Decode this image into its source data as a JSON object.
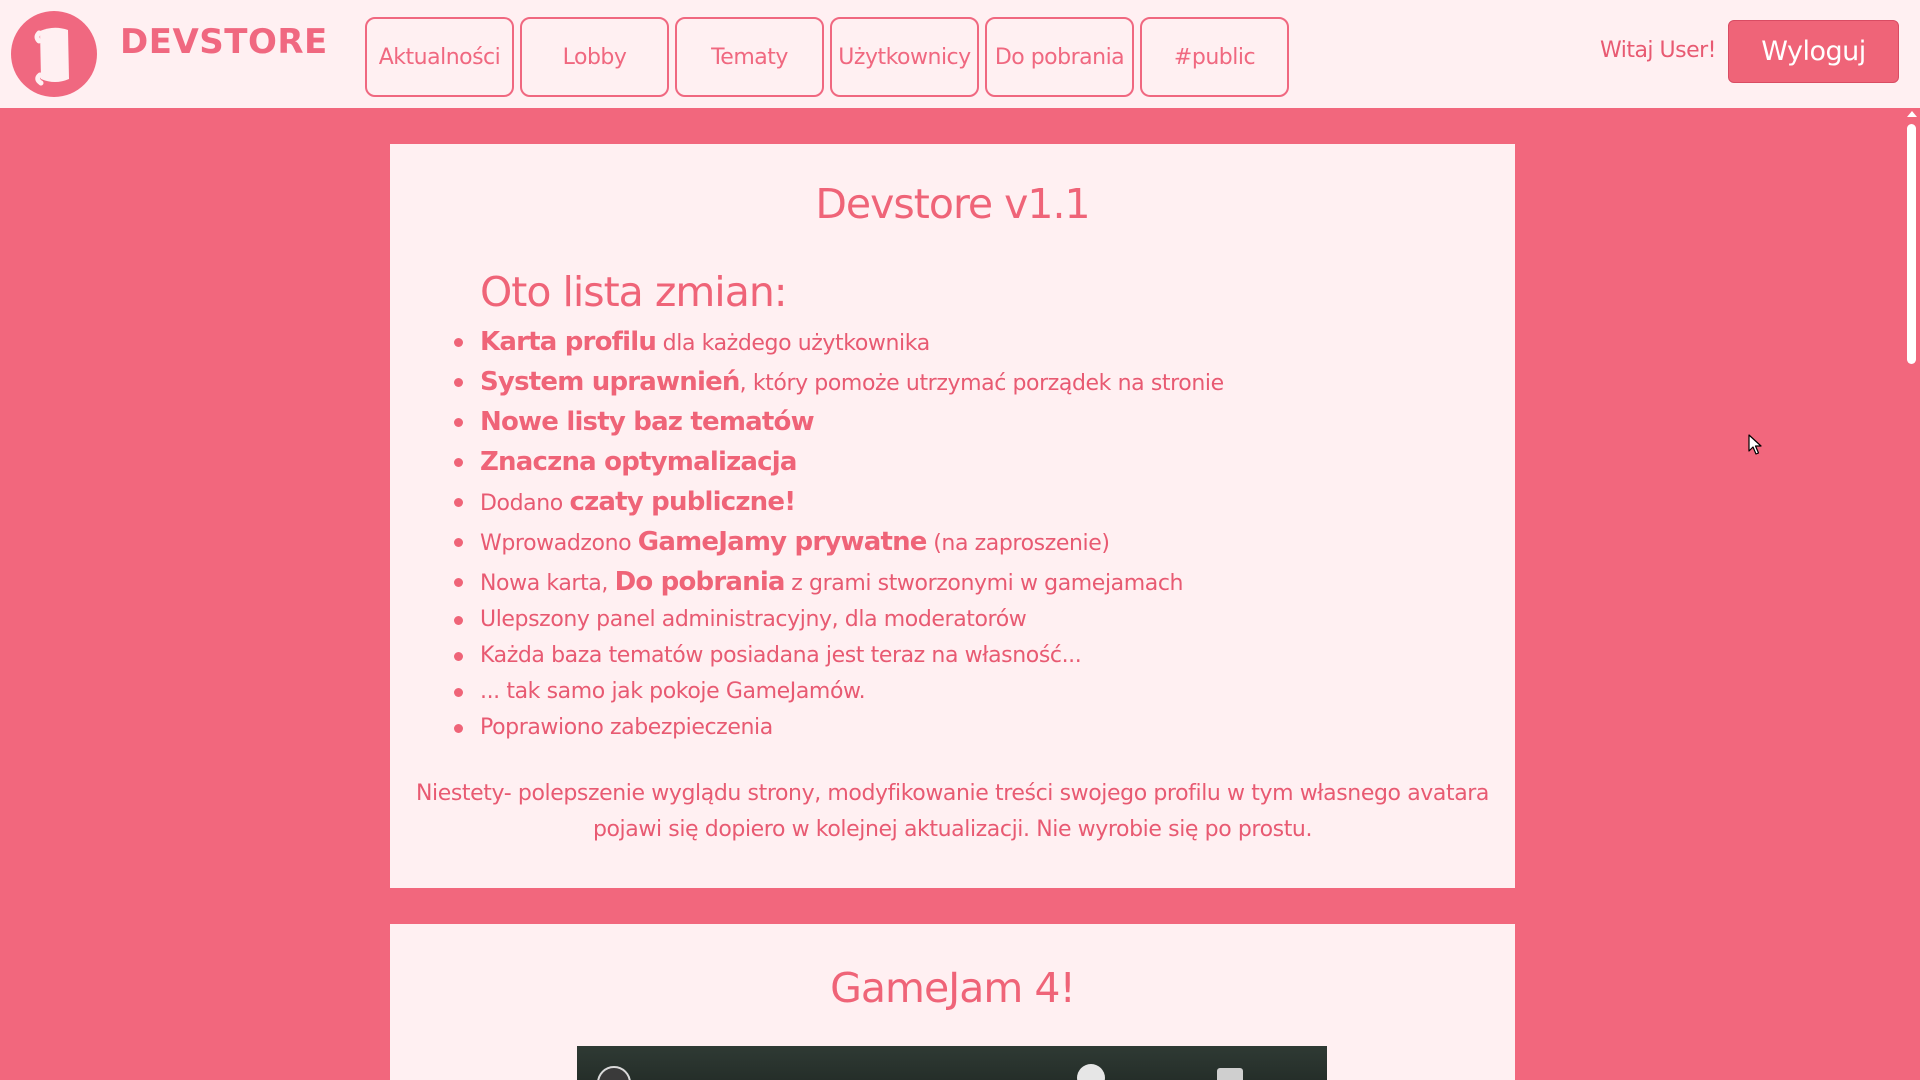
{
  "header": {
    "brand": "DEVSTORE",
    "nav": [
      "Aktualności",
      "Lobby",
      "Tematy",
      "Użytkownicy",
      "Do pobrania",
      "#public"
    ],
    "welcome": "Witaj User!",
    "logout": "Wyloguj"
  },
  "posts": [
    {
      "title": "Devstore v1.1",
      "changes_heading": "Oto lista zmian:",
      "changes": [
        {
          "pre": "",
          "bold": "Karta profilu",
          "post": " dla każdego użytkownika"
        },
        {
          "pre": "",
          "bold": "System uprawnień",
          "post": ", który pomoże utrzymać porządek na stronie"
        },
        {
          "pre": "",
          "bold": "Nowe listy baz tematów",
          "post": ""
        },
        {
          "pre": "",
          "bold": "Znaczna optymalizacja",
          "post": ""
        },
        {
          "pre": "Dodano ",
          "bold": "czaty publiczne!",
          "post": ""
        },
        {
          "pre": "Wprowadzono ",
          "bold": "GameJamy prywatne",
          "post": " (na zaproszenie)"
        },
        {
          "pre": "Nowa karta, ",
          "bold": "Do pobrania",
          "post": " z grami stworzonymi w gamejamach"
        },
        {
          "pre": "Ulepszony panel administracyjny, dla moderatorów",
          "bold": "",
          "post": ""
        },
        {
          "pre": "Każda baza tematów posiadana jest teraz na własność...",
          "bold": "",
          "post": ""
        },
        {
          "pre": "... tak samo jak pokoje GameJamów.",
          "bold": "",
          "post": ""
        },
        {
          "pre": "Poprawiono zabezpieczenia",
          "bold": "",
          "post": ""
        }
      ],
      "note": "Niestety- polepszenie wyglądu strony, modyfikowanie treści swojego profilu w tym własnego avatara pojawi się dopiero w kolejnej aktualizacji. Nie wyrobie się po prostu."
    },
    {
      "title": "GameJam 4!"
    }
  ],
  "colors": {
    "accent": "#f06880",
    "background": "#f2677d",
    "card": "#fff0f2"
  }
}
